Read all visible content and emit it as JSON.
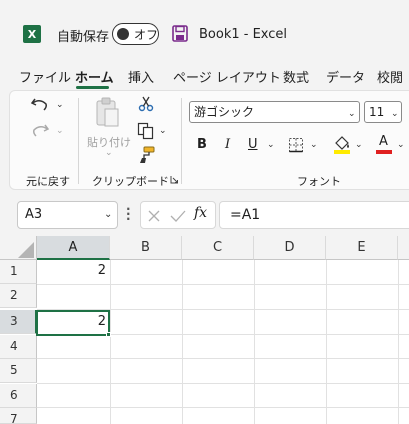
{
  "titlebar": {
    "app_logo": "X",
    "autosave_label": "自動保存",
    "toggle_state": "オフ",
    "save_icon": "save-icon",
    "document_title": "Book1  -  Excel"
  },
  "tabs": [
    "ファイル",
    "ホーム",
    "挿入",
    "ページ レイアウト",
    "数式",
    "データ",
    "校閲"
  ],
  "active_tab": "ホーム",
  "ribbon": {
    "undo_group_label": "元に戻す",
    "paste_label": "貼り付け",
    "clipboard_group_label": "クリップボード",
    "font_name": "游ゴシック",
    "font_size": "11",
    "bold": "B",
    "italic": "I",
    "underline": "U",
    "font_color_letter": "A",
    "font_group_label": "フォント"
  },
  "formula_bar": {
    "name_box": "A3",
    "fx_label": "fx",
    "formula": "=A1"
  },
  "grid": {
    "columns": [
      "A",
      "B",
      "C",
      "D",
      "E"
    ],
    "rows": [
      "1",
      "2",
      "3",
      "4",
      "5",
      "6",
      "7"
    ],
    "selected_column": "A",
    "selected_row": "3",
    "cells": {
      "A1": "2",
      "A3": "2"
    }
  },
  "colors": {
    "excel_green": "#1e7145",
    "save_purple": "#7a2a8c",
    "font_color_red": "#e02020",
    "highlight_yellow": "#ffeb00"
  }
}
